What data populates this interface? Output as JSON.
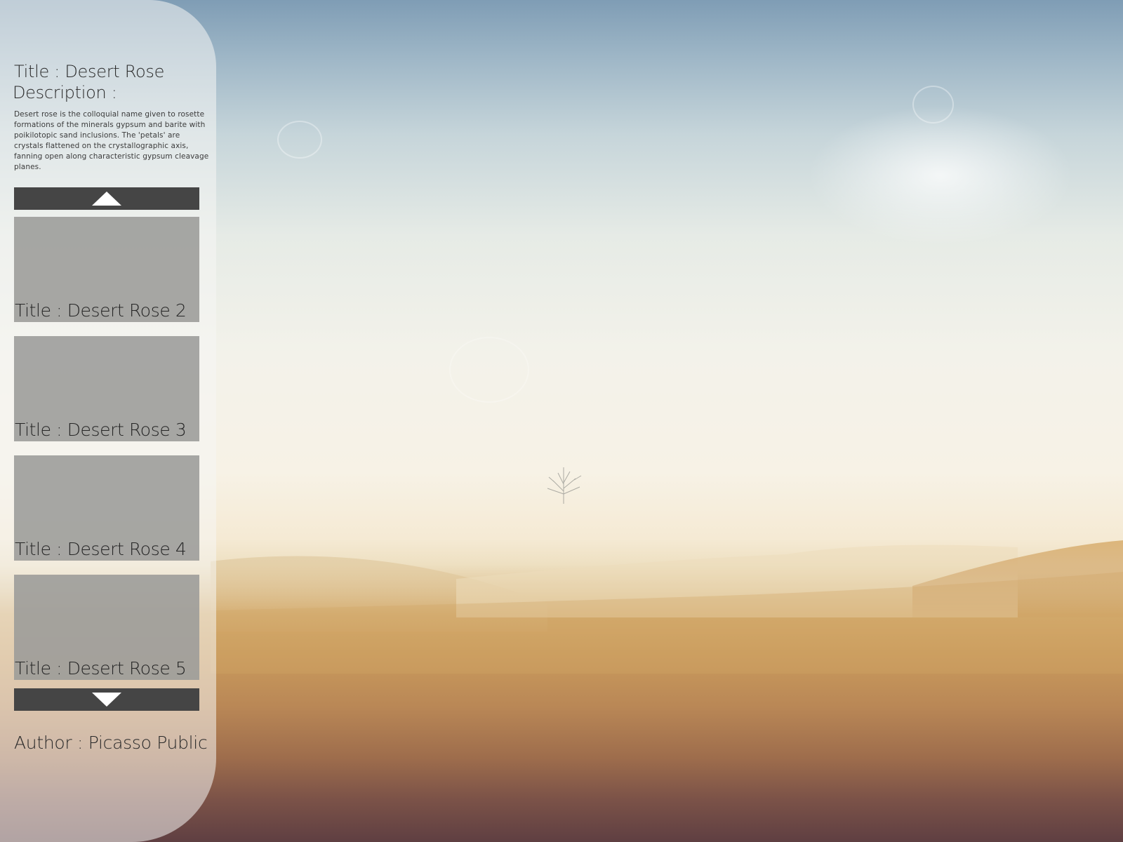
{
  "detail": {
    "title": "Title : Desert Rose",
    "description_label": "Description :",
    "description_text": "Desert rose is the colloquial name given to rosette formations of the minerals gypsum and barite with poikilotopic sand inclusions. The 'petals' are crystals flattened on the crystallographic axis, fanning open along characteristic gypsum cleavage planes."
  },
  "gallery": {
    "scroll_up_icon": "triangle-up",
    "scroll_down_icon": "triangle-down",
    "items": [
      {
        "title": "Title : Desert Rose 2"
      },
      {
        "title": "Title : Desert Rose 3"
      },
      {
        "title": "Title : Desert Rose 4"
      },
      {
        "title": "Title : Desert Rose 5"
      }
    ]
  },
  "author": "Author : Picasso Public",
  "colors": {
    "panel": "#f6f6f4",
    "button": "#454545",
    "thumbnail": "#9b9b99",
    "text": "#2a2a2a"
  }
}
